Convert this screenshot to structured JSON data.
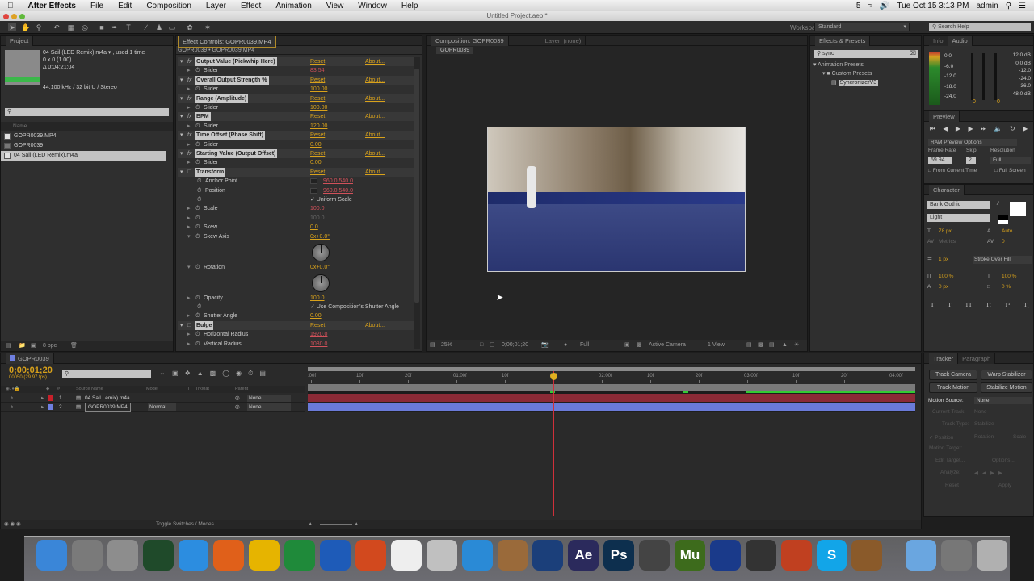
{
  "menubar": {
    "app_name": "After Effects",
    "items": [
      "File",
      "Edit",
      "Composition",
      "Layer",
      "Effect",
      "Animation",
      "View",
      "Window",
      "Help"
    ],
    "status": {
      "adobe_badge": "5",
      "clock": "Tue Oct 15  3:13 PM",
      "user": "admin"
    }
  },
  "window": {
    "title": "Untitled Project.aep *"
  },
  "toolbar": {
    "workspace_label": "Workspace:",
    "workspace_value": "Standard",
    "search_help_placeholder": "Search Help"
  },
  "project": {
    "tab": "Project",
    "selected_name": "04 Sail (LED Remix).m4a ▾ , used 1 time",
    "dims": "0 x 0 (1.00)",
    "duration": "Δ 0:04:21:04",
    "audio_info": "44.100 kHz / 32 bit U / Stereo",
    "search_value": "",
    "column_name": "Name",
    "items": [
      {
        "name": "GOPR0039.MP4",
        "icon": "footage-icon",
        "selected": false
      },
      {
        "name": "GOPR0039",
        "icon": "composition-icon",
        "selected": false
      },
      {
        "name": "04 Sail (LED Remix).m4a",
        "icon": "audio-file-icon",
        "selected": true
      }
    ],
    "bpc": "8 bpc"
  },
  "effect_controls": {
    "tab": "Effect Controls: GOPR0039.MP4",
    "breadcrumb": "GOPR0039 • GOPR0039.MP4",
    "reset_label": "Reset",
    "about_label": "About...",
    "rows": [
      {
        "kind": "hdr",
        "name": "Output Value (Pickwhip Here)",
        "fx": true
      },
      {
        "kind": "prop",
        "name": "Slider",
        "value": "83.54",
        "color": "red"
      },
      {
        "kind": "hdr",
        "name": "Overall Output Strength %",
        "fx": true
      },
      {
        "kind": "prop",
        "name": "Slider",
        "value": "100.00",
        "color": "gold"
      },
      {
        "kind": "hdr",
        "name": "Range (Amplitude)",
        "fx": true
      },
      {
        "kind": "prop",
        "name": "Slider",
        "value": "100.00",
        "color": "gold"
      },
      {
        "kind": "hdr",
        "name": "BPM",
        "fx": true
      },
      {
        "kind": "prop",
        "name": "Slider",
        "value": "120.00",
        "color": "gold"
      },
      {
        "kind": "hdr",
        "name": "Time Offset (Phase Shift)",
        "fx": true
      },
      {
        "kind": "prop",
        "name": "Slider",
        "value": "0.00",
        "color": "gold"
      },
      {
        "kind": "hdr",
        "name": "Starting Value (Output Offset)",
        "fx": true
      },
      {
        "kind": "prop",
        "name": "Slider",
        "value": "0.00",
        "color": "gold"
      },
      {
        "kind": "hdr",
        "name": "Transform",
        "fx": false
      },
      {
        "kind": "sub",
        "name": "Anchor Point",
        "value": "960.0,540.0",
        "color": "red"
      },
      {
        "kind": "sub",
        "name": "Position",
        "value": "960.0,540.0",
        "color": "red"
      },
      {
        "kind": "sub",
        "name": "",
        "value": "✓ Uniform Scale",
        "color": "plain"
      },
      {
        "kind": "prop",
        "name": "Scale",
        "value": "100.0",
        "color": "red"
      },
      {
        "kind": "prop",
        "name": "",
        "value": "100.0",
        "color": "dim"
      },
      {
        "kind": "prop",
        "name": "Skew",
        "value": "0.0",
        "color": "gold"
      },
      {
        "kind": "prop",
        "name": "Skew Axis",
        "value": "0x+0.0°",
        "color": "gold",
        "dial": true
      },
      {
        "kind": "prop",
        "name": "Rotation",
        "value": "0x+0.0°",
        "color": "gold",
        "dial": true
      },
      {
        "kind": "prop",
        "name": "Opacity",
        "value": "100.0",
        "color": "gold"
      },
      {
        "kind": "sub",
        "name": "",
        "value": "✓ Use Composition's Shutter Angle",
        "color": "plain"
      },
      {
        "kind": "prop",
        "name": "Shutter Angle",
        "value": "0.00",
        "color": "gold"
      },
      {
        "kind": "hdr",
        "name": "Bulge",
        "fx": false
      },
      {
        "kind": "prop",
        "name": "Horizontal Radius",
        "value": "1920.0",
        "color": "red"
      },
      {
        "kind": "prop",
        "name": "Vertical Radius",
        "value": "1080.0",
        "color": "red"
      }
    ]
  },
  "composition": {
    "tab": "Composition: GOPR0039",
    "layer_tab": "Layer: (none)",
    "comp_tab": "GOPR0039",
    "footer": {
      "zoom": "25%",
      "timecode": "0;00;01;20",
      "resolution": "Full",
      "camera": "Active Camera",
      "views": "1 View"
    }
  },
  "effects_presets": {
    "tab": "Effects & Presets",
    "search_value": "sync",
    "tree": [
      {
        "label": "Animation Presets",
        "level": 0
      },
      {
        "label": "Custom Presets",
        "level": 1
      },
      {
        "label": "SyncronizerV3",
        "level": 2,
        "selected": true
      }
    ]
  },
  "audio": {
    "tabs": [
      "Info",
      "Audio"
    ],
    "meter_labels": [
      "0.0",
      "-6.0",
      "-12.0",
      "-18.0",
      "-24.0"
    ],
    "db_labels": [
      "12.0 dB",
      "0.0 dB",
      "-12.0",
      "-24.0",
      "-36.0",
      "-48.0 dB"
    ],
    "left_value": "0",
    "right_value": "0"
  },
  "preview": {
    "tab": "Preview",
    "options": "RAM Preview Options",
    "frame_rate_label": "Frame Rate",
    "skip_label": "Skip",
    "resolution_label": "Resolution",
    "frame_rate": "59.94",
    "skip": "2",
    "resolution": "Full",
    "from_current_time": "From Current Time",
    "full_screen": "Full Screen"
  },
  "character": {
    "tab": "Character",
    "font": "Bank Gothic",
    "style": "Light",
    "size": "78 px",
    "leading": "Auto",
    "kerning": "Metrics",
    "tracking": "0",
    "stroke_width": "1 px",
    "stroke_mode": "Stroke Over Fill",
    "vertical_scale": "100 %",
    "horizontal_scale": "100 %",
    "baseline_shift": "0 px",
    "tsume": "0 %",
    "style_buttons": [
      "T",
      "T",
      "TT",
      "Tt",
      "T¹",
      "T₁"
    ]
  },
  "timeline": {
    "tab": "GOPR0039",
    "timecode": "0;00;01;20",
    "frame_info": "00050 (29.97 fps)",
    "columns": {
      "source_name": "Source Name",
      "mode": "Mode",
      "t": "T",
      "trkmat": "TrkMat",
      "parent": "Parent",
      "num": "#"
    },
    "layers": [
      {
        "num": "1",
        "name": "04 Sail...emix).m4a",
        "label_color": "#c8202a",
        "mode": "",
        "parent": "None",
        "bar_color": "#8b2a36"
      },
      {
        "num": "2",
        "name": "GOPR0039.MP4",
        "label_color": "#6f7fe0",
        "mode": "Normal",
        "parent": "None",
        "bar_color": "#6a7ad8"
      }
    ],
    "ruler": [
      ":00f",
      "10f",
      "20f",
      "01:00f",
      "10f",
      "20f",
      "02:00f",
      "10f",
      "20f",
      "03:00f",
      "10f",
      "20f",
      "04:00f"
    ],
    "playhead_frame": 50,
    "frames_per_second": 30,
    "toggle_label": "Toggle Switches / Modes"
  },
  "tracker": {
    "tabs": [
      "Tracker",
      "Paragraph"
    ],
    "buttons": [
      "Track Camera",
      "Warp Stabilizer",
      "Track Motion",
      "Stabilize Motion"
    ],
    "motion_source_label": "Motion Source:",
    "motion_source": "None",
    "current_track_label": "Current Track:",
    "current_track": "None",
    "track_type_label": "Track Type:",
    "track_type": "Stabilize",
    "position": "✓ Position",
    "rotation": "Rotation",
    "scale": "Scale",
    "motion_target_label": "Motion Target:",
    "edit_target": "Edit Target...",
    "options": "Options...",
    "analyze_label": "Analyze:",
    "reset": "Reset",
    "apply": "Apply"
  },
  "dock": [
    {
      "icon": "finder-icon",
      "color": "#3a86d8"
    },
    {
      "icon": "launchpad-icon",
      "color": "#7a7a7a"
    },
    {
      "icon": "calculator-icon",
      "color": "#8d8d8d"
    },
    {
      "icon": "activity-monitor-icon",
      "color": "#1f4a2a"
    },
    {
      "icon": "safari-icon",
      "color": "#2c8de0"
    },
    {
      "icon": "firefox-icon",
      "color": "#e0601a"
    },
    {
      "icon": "norton-icon",
      "color": "#e6b400"
    },
    {
      "icon": "excel-icon",
      "color": "#1f8a3a"
    },
    {
      "icon": "word-icon",
      "color": "#1e5bb8"
    },
    {
      "icon": "powerpoint-icon",
      "color": "#d2491e"
    },
    {
      "icon": "calendar-icon",
      "color": "#eeeeee"
    },
    {
      "icon": "photo-icon",
      "color": "#c0c0c0"
    },
    {
      "icon": "itunes-icon",
      "color": "#2a8ad6"
    },
    {
      "icon": "preview-icon",
      "color": "#9a6a3a"
    },
    {
      "icon": "quicktime-icon",
      "color": "#1b3f7a"
    },
    {
      "icon": "after-effects-icon",
      "color": "#2b2a5c",
      "label": "Ae"
    },
    {
      "icon": "photoshop-icon",
      "color": "#0d2f4e",
      "label": "Ps"
    },
    {
      "icon": "final-cut-icon",
      "color": "#444444"
    },
    {
      "icon": "muse-icon",
      "color": "#3d6b1c",
      "label": "Mu"
    },
    {
      "icon": "cinema4d-icon",
      "color": "#1a3a8a"
    },
    {
      "icon": "gopro-icon",
      "color": "#333333"
    },
    {
      "icon": "garageband-icon",
      "color": "#c04020"
    },
    {
      "icon": "skype-icon",
      "color": "#12a5e8",
      "label": "S"
    },
    {
      "icon": "guitar-icon",
      "color": "#8a5a2a"
    },
    {
      "icon": "folder-icon",
      "color": "#6aa6e0"
    },
    {
      "icon": "downloads-icon",
      "color": "#777777"
    },
    {
      "icon": "trash-icon",
      "color": "#b0b0b0"
    }
  ]
}
